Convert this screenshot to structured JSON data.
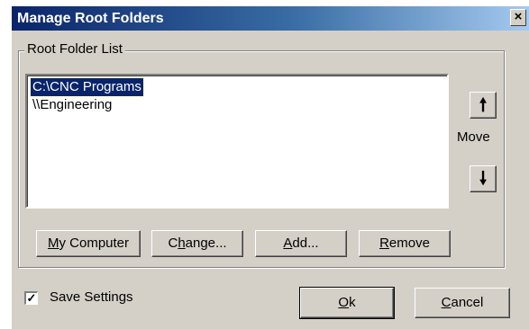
{
  "window": {
    "title": "Manage Root Folders",
    "close_glyph": "×"
  },
  "group": {
    "legend": "Root Folder List"
  },
  "list": {
    "items": [
      {
        "label": "C:\\CNC Programs",
        "selected": true
      },
      {
        "label": "\\\\Engineering",
        "selected": false
      }
    ]
  },
  "move": {
    "up_glyph": "🠕",
    "down_glyph": "🠗",
    "label": "Move"
  },
  "buttons": {
    "my_computer": {
      "accel": "M",
      "rest": "y Computer"
    },
    "change": {
      "pre": "C",
      "accel": "h",
      "rest": "ange..."
    },
    "add": {
      "accel": "A",
      "rest": "dd..."
    },
    "remove": {
      "accel": "R",
      "rest": "emove"
    },
    "ok": {
      "accel": "O",
      "rest": "k"
    },
    "cancel": {
      "accel": "C",
      "rest": "ancel"
    }
  },
  "settings": {
    "save_label": "Save Settings",
    "save_checked": true,
    "check_glyph": "✓"
  }
}
